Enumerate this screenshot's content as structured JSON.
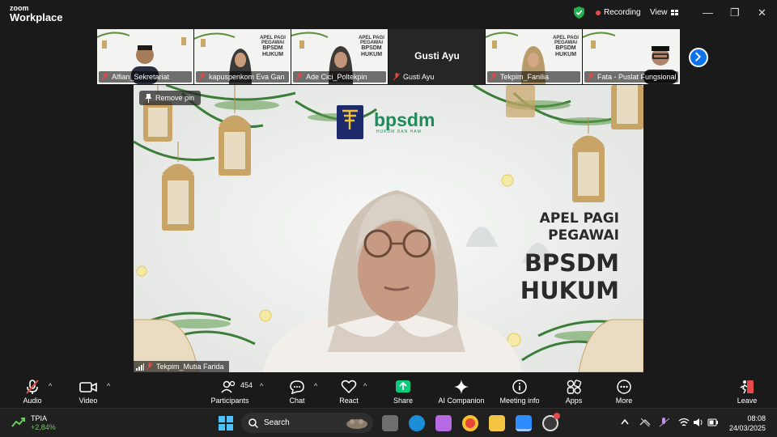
{
  "app": {
    "brand_line1": "zoom",
    "brand_line2": "Workplace"
  },
  "header": {
    "recording_label": "Recording",
    "view_label": "View",
    "minimize": "—",
    "maximize": "❐",
    "close": "✕"
  },
  "thumbnails": [
    {
      "name": "Alfian_Sekretariat"
    },
    {
      "name": "kapuspenkom Eva Gan"
    },
    {
      "name": "Ade Cici_Poltekpin"
    },
    {
      "name": "Gusti Ayu",
      "big_name": "Gusti Ayu"
    },
    {
      "name": "Tekpim_Fanilia"
    },
    {
      "name": "Fata - Puslat Fungsional"
    }
  ],
  "thumb_banner": {
    "l1": "APEL PAGI",
    "l2": "PEGAWAI",
    "l3": "BPSDM",
    "l4": "HUKUM",
    "logo": "bpsdm"
  },
  "main_video": {
    "remove_pin": "Remove pin",
    "participant": "Tekpim_Mutia Farida",
    "logo_text": "bpsdm",
    "logo_sub": "HUKUM DAN HAM",
    "seal_text": "PENGAYOMAN",
    "banner_l1": "APEL PAGI",
    "banner_l2": "PEGAWAI",
    "banner_l3": "BPSDM",
    "banner_l4": "HUKUM"
  },
  "toolbar": {
    "audio": "Audio",
    "video": "Video",
    "participants": "Participants",
    "participants_count": "454",
    "chat": "Chat",
    "react": "React",
    "share": "Share",
    "ai": "AI Companion",
    "meeting_info": "Meeting info",
    "apps": "Apps",
    "more": "More",
    "leave": "Leave"
  },
  "taskbar": {
    "stock_name": "TPIA",
    "stock_change": "+2,84%",
    "search_placeholder": "Search",
    "time": "08:08",
    "date": "24/03/2025"
  },
  "colors": {
    "accent": "#0e72ed",
    "share_green": "#0bcb7b",
    "logo_green": "#1f8a5a",
    "record_red": "#e34a4a"
  }
}
